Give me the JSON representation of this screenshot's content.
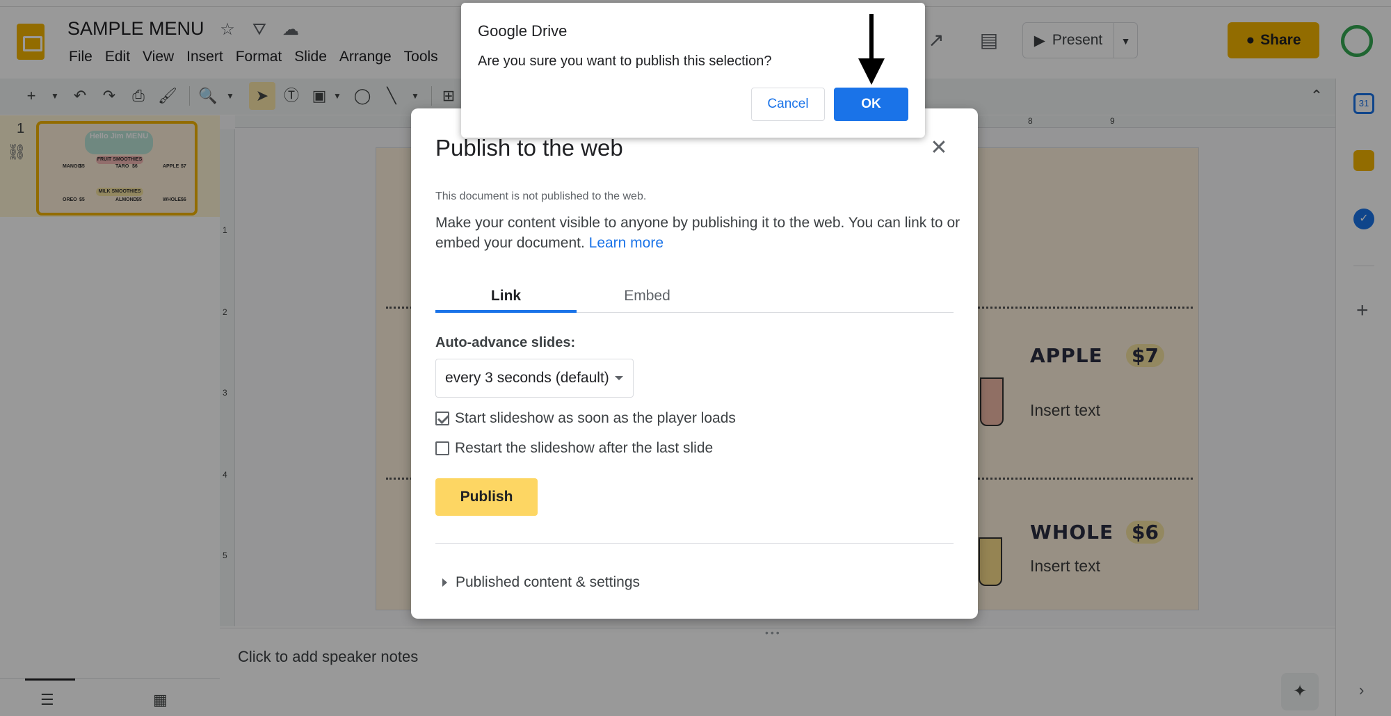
{
  "app": {
    "title": "SAMPLE MENU",
    "menu": [
      "File",
      "Edit",
      "View",
      "Insert",
      "Format",
      "Slide",
      "Arrange",
      "Tools"
    ]
  },
  "header": {
    "present_label": "Present",
    "share_label": "Share"
  },
  "filmstrip": {
    "slide_number": "1",
    "thumb_title": "Hello Jim MENU",
    "thumb_fruit": "FRUIT SMOOTHIES",
    "thumb_milk": "MILK SMOOTHIES",
    "thumb_items": [
      "MANGO",
      "TARO",
      "APPLE",
      "OREO",
      "ALMOND",
      "WHOLE"
    ],
    "thumb_prices": [
      "$5",
      "$6",
      "$7",
      "$5",
      "$5",
      "$6"
    ]
  },
  "ruler": {
    "top_labels": [
      "8",
      "9"
    ],
    "left_labels": [
      "1",
      "2",
      "3",
      "4",
      "5"
    ]
  },
  "slide": {
    "items": [
      {
        "name": "APPLE",
        "price": "$7",
        "text": "Insert text"
      },
      {
        "name": "WHOLE",
        "price": "$6",
        "text": "Insert text"
      }
    ]
  },
  "notes": {
    "placeholder": "Click to add speaker notes"
  },
  "publish_dialog": {
    "title": "Publish to the web",
    "status": "This document is not published to the web.",
    "description": "Make your content visible to anyone by publishing it to the web. You can link to or embed your document.",
    "learn_more": "Learn more",
    "tabs": [
      "Link",
      "Embed"
    ],
    "auto_advance_label": "Auto-advance slides:",
    "auto_advance_value": "every 3 seconds (default)",
    "checkbox_start": {
      "label": "Start slideshow as soon as the player loads",
      "checked": true
    },
    "checkbox_restart": {
      "label": "Restart the slideshow after the last slide",
      "checked": false
    },
    "publish_label": "Publish",
    "settings_label": "Published content & settings"
  },
  "confirm_dialog": {
    "title": "Google Drive",
    "message": "Are you sure you want to publish this selection?",
    "cancel_label": "Cancel",
    "ok_label": "OK"
  },
  "colors": {
    "accent": "#1a73e8",
    "brand": "#f4b400",
    "publish_button": "#fdd663"
  }
}
